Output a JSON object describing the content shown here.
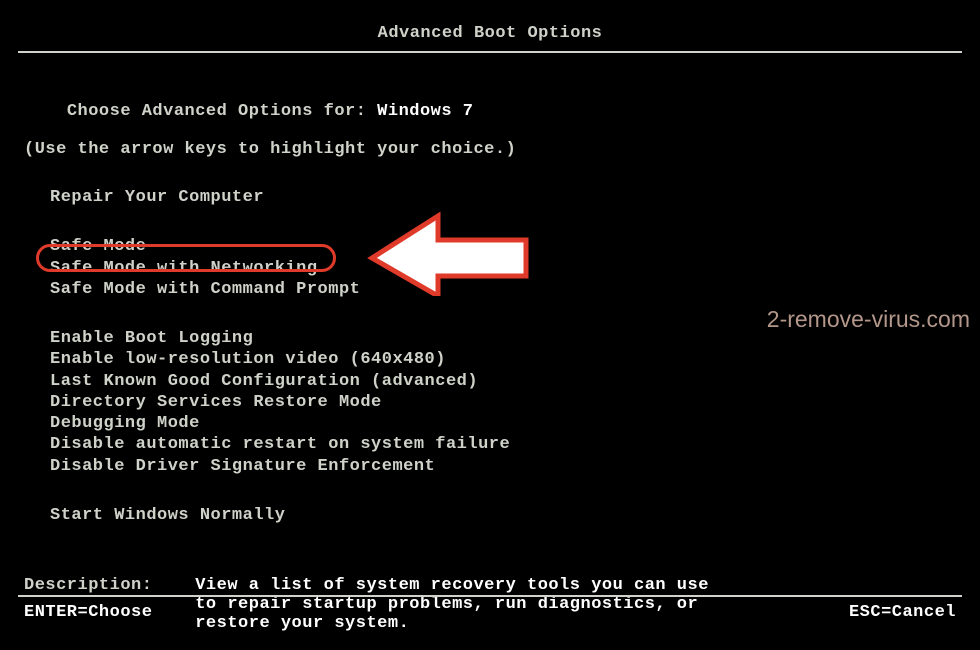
{
  "title": "Advanced Boot Options",
  "prompt_prefix": "Choose Advanced Options for: ",
  "os_name": "Windows 7",
  "hint": "(Use the arrow keys to highlight your choice.)",
  "group_repair": {
    "items": [
      "Repair Your Computer"
    ]
  },
  "group_safe": {
    "items": [
      "Safe Mode",
      "Safe Mode with Networking",
      "Safe Mode with Command Prompt"
    ],
    "highlighted_index": 2
  },
  "group_misc": {
    "items": [
      "Enable Boot Logging",
      "Enable low-resolution video (640x480)",
      "Last Known Good Configuration (advanced)",
      "Directory Services Restore Mode",
      "Debugging Mode",
      "Disable automatic restart on system failure",
      "Disable Driver Signature Enforcement"
    ]
  },
  "group_start": {
    "items": [
      "Start Windows Normally"
    ]
  },
  "description_label": "Description:",
  "description_text": "View a list of system recovery tools you can use to repair startup problems, run diagnostics, or restore your system.",
  "footer_left": "ENTER=Choose",
  "footer_right": "ESC=Cancel",
  "watermark": "2-remove-virus.com",
  "annotation": {
    "oval": "safe-mode-cmd-highlight",
    "arrow": "pointer-arrow"
  },
  "colors": {
    "highlight": "#e03a2a"
  }
}
